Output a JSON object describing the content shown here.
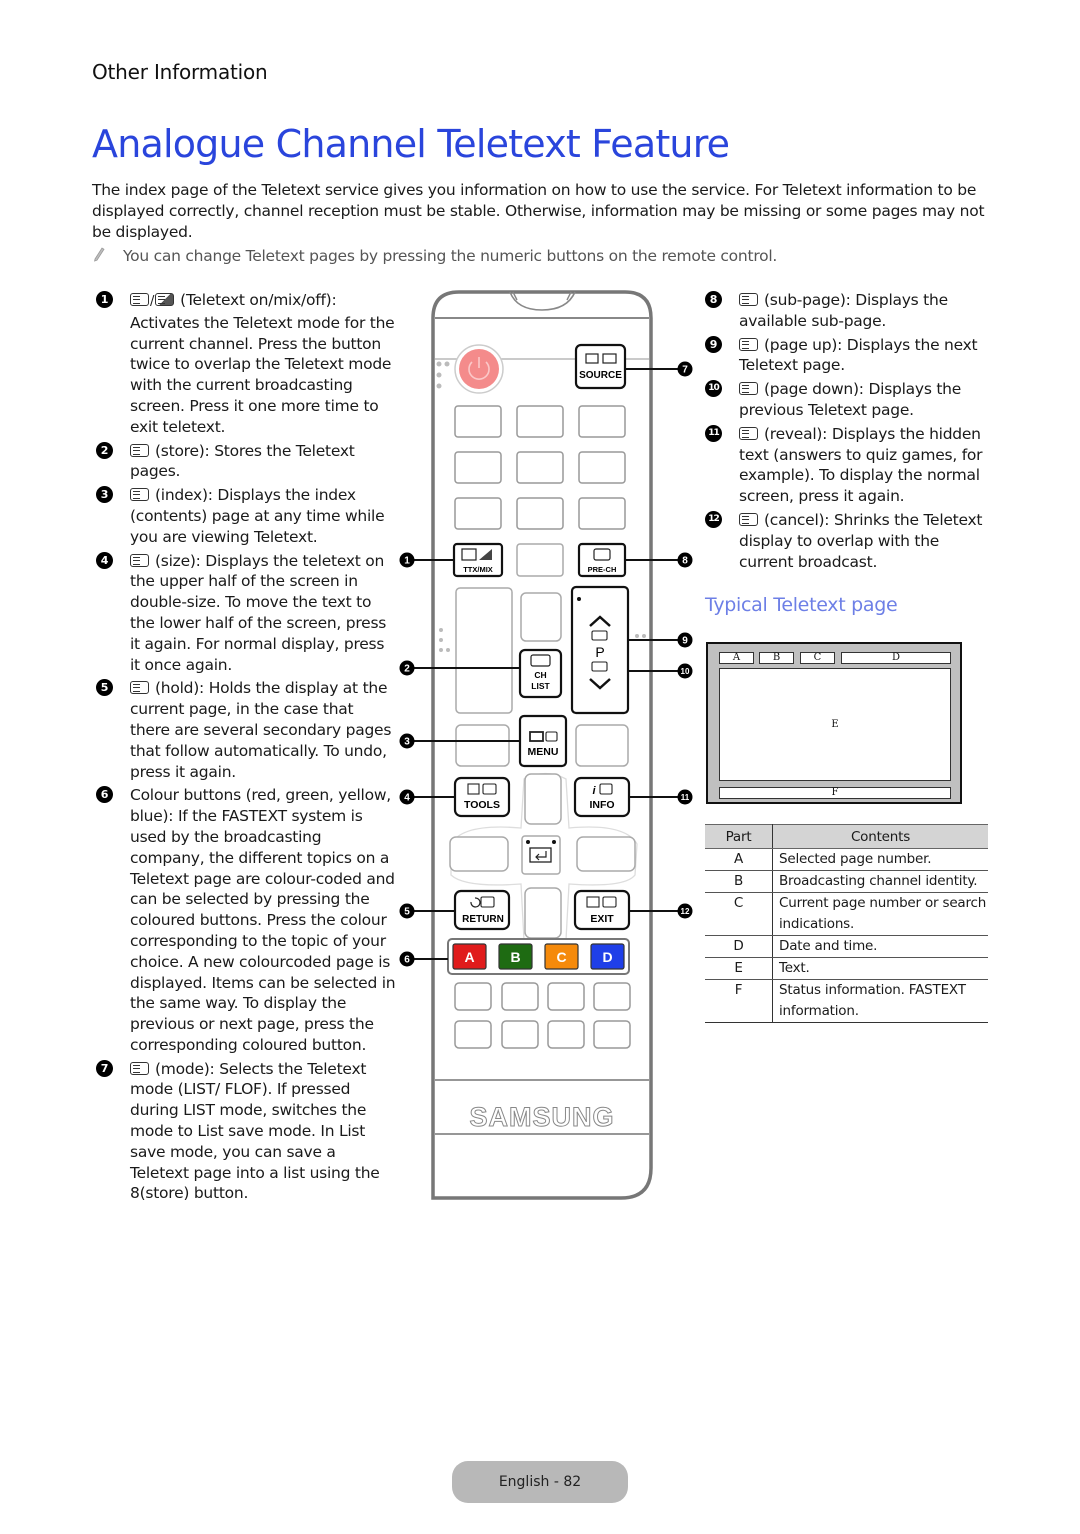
{
  "header": {
    "section_label": "Other Information",
    "title": "Analogue Channel Teletext Feature"
  },
  "intro": "The index page of the Teletext service gives you information on how to use the service. For Teletext information to be displayed correctly, channel reception must be stable. Otherwise, information may be missing or some pages may not be displayed.",
  "note": {
    "icon": "pencil-icon",
    "text": "You can change Teletext pages by pressing the numeric buttons on the remote control."
  },
  "left_items": [
    {
      "num": "1",
      "icon": "teletext-mix-icon",
      "text": "(Teletext on/mix/off): Activates the Teletext mode for the current channel. Press the button twice to overlap the Teletext mode with the current broadcasting screen. Press it one more time to exit teletext."
    },
    {
      "num": "2",
      "icon": "store-icon",
      "text": "(store): Stores the Teletext pages."
    },
    {
      "num": "3",
      "icon": "index-icon",
      "text": "(index): Displays the index (contents) page at any time while you are viewing Teletext."
    },
    {
      "num": "4",
      "icon": "size-icon",
      "text": "(size): Displays the teletext on the upper half of the screen in double-size. To move the text to the lower half of the screen, press it again. For normal display, press it once again."
    },
    {
      "num": "5",
      "icon": "hold-icon",
      "text": "(hold): Holds the display at the current page, in the case that there are several secondary pages that follow automatically. To undo, press it again."
    },
    {
      "num": "6",
      "icon": "",
      "text": "Colour buttons (red, green, yellow, blue): If the FASTEXT system is used by the broadcasting company, the different topics on a Teletext page are colour-coded and can be selected by pressing the coloured buttons. Press the colour corresponding to the topic of your choice. A new colourcoded page is displayed. Items can be selected in the same way. To display the previous or next page, press the corresponding coloured button."
    },
    {
      "num": "7",
      "icon": "mode-icon",
      "text": "(mode): Selects the Teletext mode (LIST/ FLOF). If pressed during LIST mode, switches the mode to List save mode. In List save mode, you can save a Teletext page into a list using the 8(store) button."
    }
  ],
  "right_items": [
    {
      "num": "8",
      "icon": "sub-page-icon",
      "text": "(sub-page): Displays the available sub-page."
    },
    {
      "num": "9",
      "icon": "page-up-icon",
      "text": "(page up): Displays the next Teletext page."
    },
    {
      "num": "10",
      "icon": "page-down-icon",
      "text": "(page down): Displays the previous Teletext page."
    },
    {
      "num": "11",
      "icon": "reveal-icon",
      "text": "(reveal): Displays the hidden text (answers to quiz games, for example). To display the normal screen, press it again."
    },
    {
      "num": "12",
      "icon": "cancel-icon",
      "text": "(cancel): Shrinks the Teletext display to overlap with the current broadcast."
    }
  ],
  "remote": {
    "brand": "SAMSUNG",
    "buttons": {
      "source": "SOURCE",
      "ttx_mix": "TTX/MIX",
      "pre_ch": "PRE-CH",
      "ch_list_1": "CH",
      "ch_list_2": "LIST",
      "p": "P",
      "menu": "MENU",
      "tools": "TOOLS",
      "info": "INFO",
      "return": "RETURN",
      "exit": "EXIT",
      "color_a": "A",
      "color_b": "B",
      "color_c": "C",
      "color_d": "D"
    },
    "colors": {
      "power": "#f48b8b",
      "a": "#e01b1b",
      "b": "#1e6b12",
      "c": "#f58a0b",
      "d": "#1f3fe8"
    },
    "callouts": [
      "1",
      "2",
      "3",
      "4",
      "5",
      "6",
      "7",
      "8",
      "9",
      "10",
      "11",
      "12"
    ]
  },
  "teletext_page": {
    "heading": "Typical Teletext page",
    "labels": {
      "a": "A",
      "b": "B",
      "c": "C",
      "d": "D",
      "e": "E",
      "f": "F"
    }
  },
  "parts_table": {
    "headers": [
      "Part",
      "Contents"
    ],
    "rows": [
      {
        "part": "A",
        "contents": "Selected page number."
      },
      {
        "part": "B",
        "contents": "Broadcasting channel identity."
      },
      {
        "part": "C",
        "contents": "Current page number or search indications."
      },
      {
        "part": "D",
        "contents": "Date and time."
      },
      {
        "part": "E",
        "contents": "Text."
      },
      {
        "part": "F",
        "contents": "Status information. FASTEXT information."
      }
    ]
  },
  "footer": {
    "page_label": "English - 82"
  },
  "colors": {
    "title": "#2a45dc",
    "subheading": "#6d7fe6",
    "note_text": "#555555"
  }
}
